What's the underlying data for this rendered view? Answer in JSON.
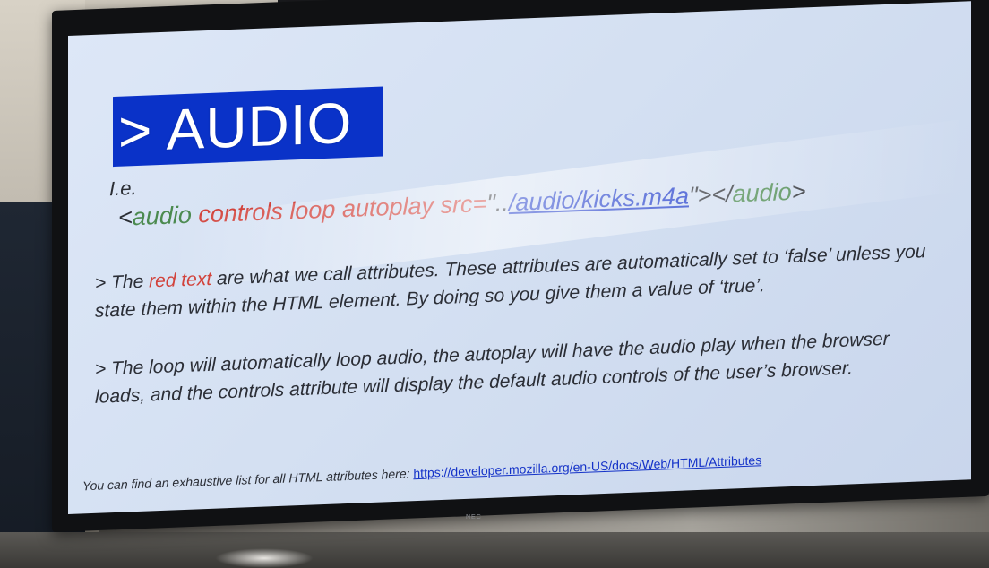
{
  "slide": {
    "title": "> AUDIO",
    "example_label": "I.e.",
    "code": {
      "open_bracket": "<",
      "tag_open": "audio",
      "attributes": " controls loop autoplay src=",
      "src_prefix": "\"..",
      "src_link": "/audio/kicks.m4a",
      "src_suffix": "\">",
      "close_prefix": "</",
      "tag_close": "audio",
      "close_suffix": ">"
    },
    "paragraph1": {
      "lead": "> The ",
      "red_text": "red text",
      "rest": " are what we call attributes. These attributes are automatically set to ‘false’ unless you state them within the HTML element. By doing so you give them a value of ‘true’."
    },
    "paragraph2": "> The loop will automatically loop audio, the autoplay will have the audio play when the browser loads, and the controls attribute will display the default audio controls of the user’s browser.",
    "footer": {
      "text": "You can find an exhaustive list for all HTML attributes here: ",
      "link": "https://developer.mozilla.org/en-US/docs/Web/HTML/Attributes"
    }
  },
  "monitor": {
    "brand": "NEC"
  },
  "colors": {
    "title_bg": "#0a32c8",
    "tag_green": "#4b8a4f",
    "attr_red": "#d2423b",
    "link_blue": "#1432c8"
  }
}
